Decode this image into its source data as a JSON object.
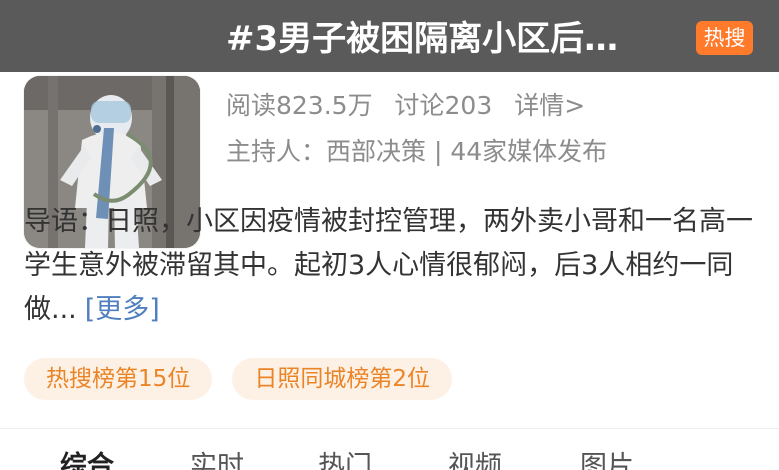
{
  "topic": {
    "title": "#3男子被困隔离小区后…",
    "hot_badge": "热搜",
    "reads": "阅读823.5万",
    "discussions": "讨论203",
    "details": "详情>",
    "host": "主持人：西部决策 | 44家媒体发布",
    "cover_icon": "protective-suit-photo"
  },
  "intro": {
    "text": "导语：日照，小区因疫情被封控管理，两外卖小哥和一名高一学生意外被滞留其中。起初3人心情很郁闷，后3人相约一同做...",
    "more": "[更多]"
  },
  "tags": [
    "热搜榜第15位",
    "日照同城榜第2位"
  ],
  "tabs": [
    "综合",
    "实时",
    "热门",
    "视频",
    "图片"
  ],
  "colors": {
    "accent_orange": "#ff7b2b",
    "tag_text": "#ea8527",
    "tag_bg": "#fdf1e6",
    "link_blue": "#4f7fbf"
  }
}
